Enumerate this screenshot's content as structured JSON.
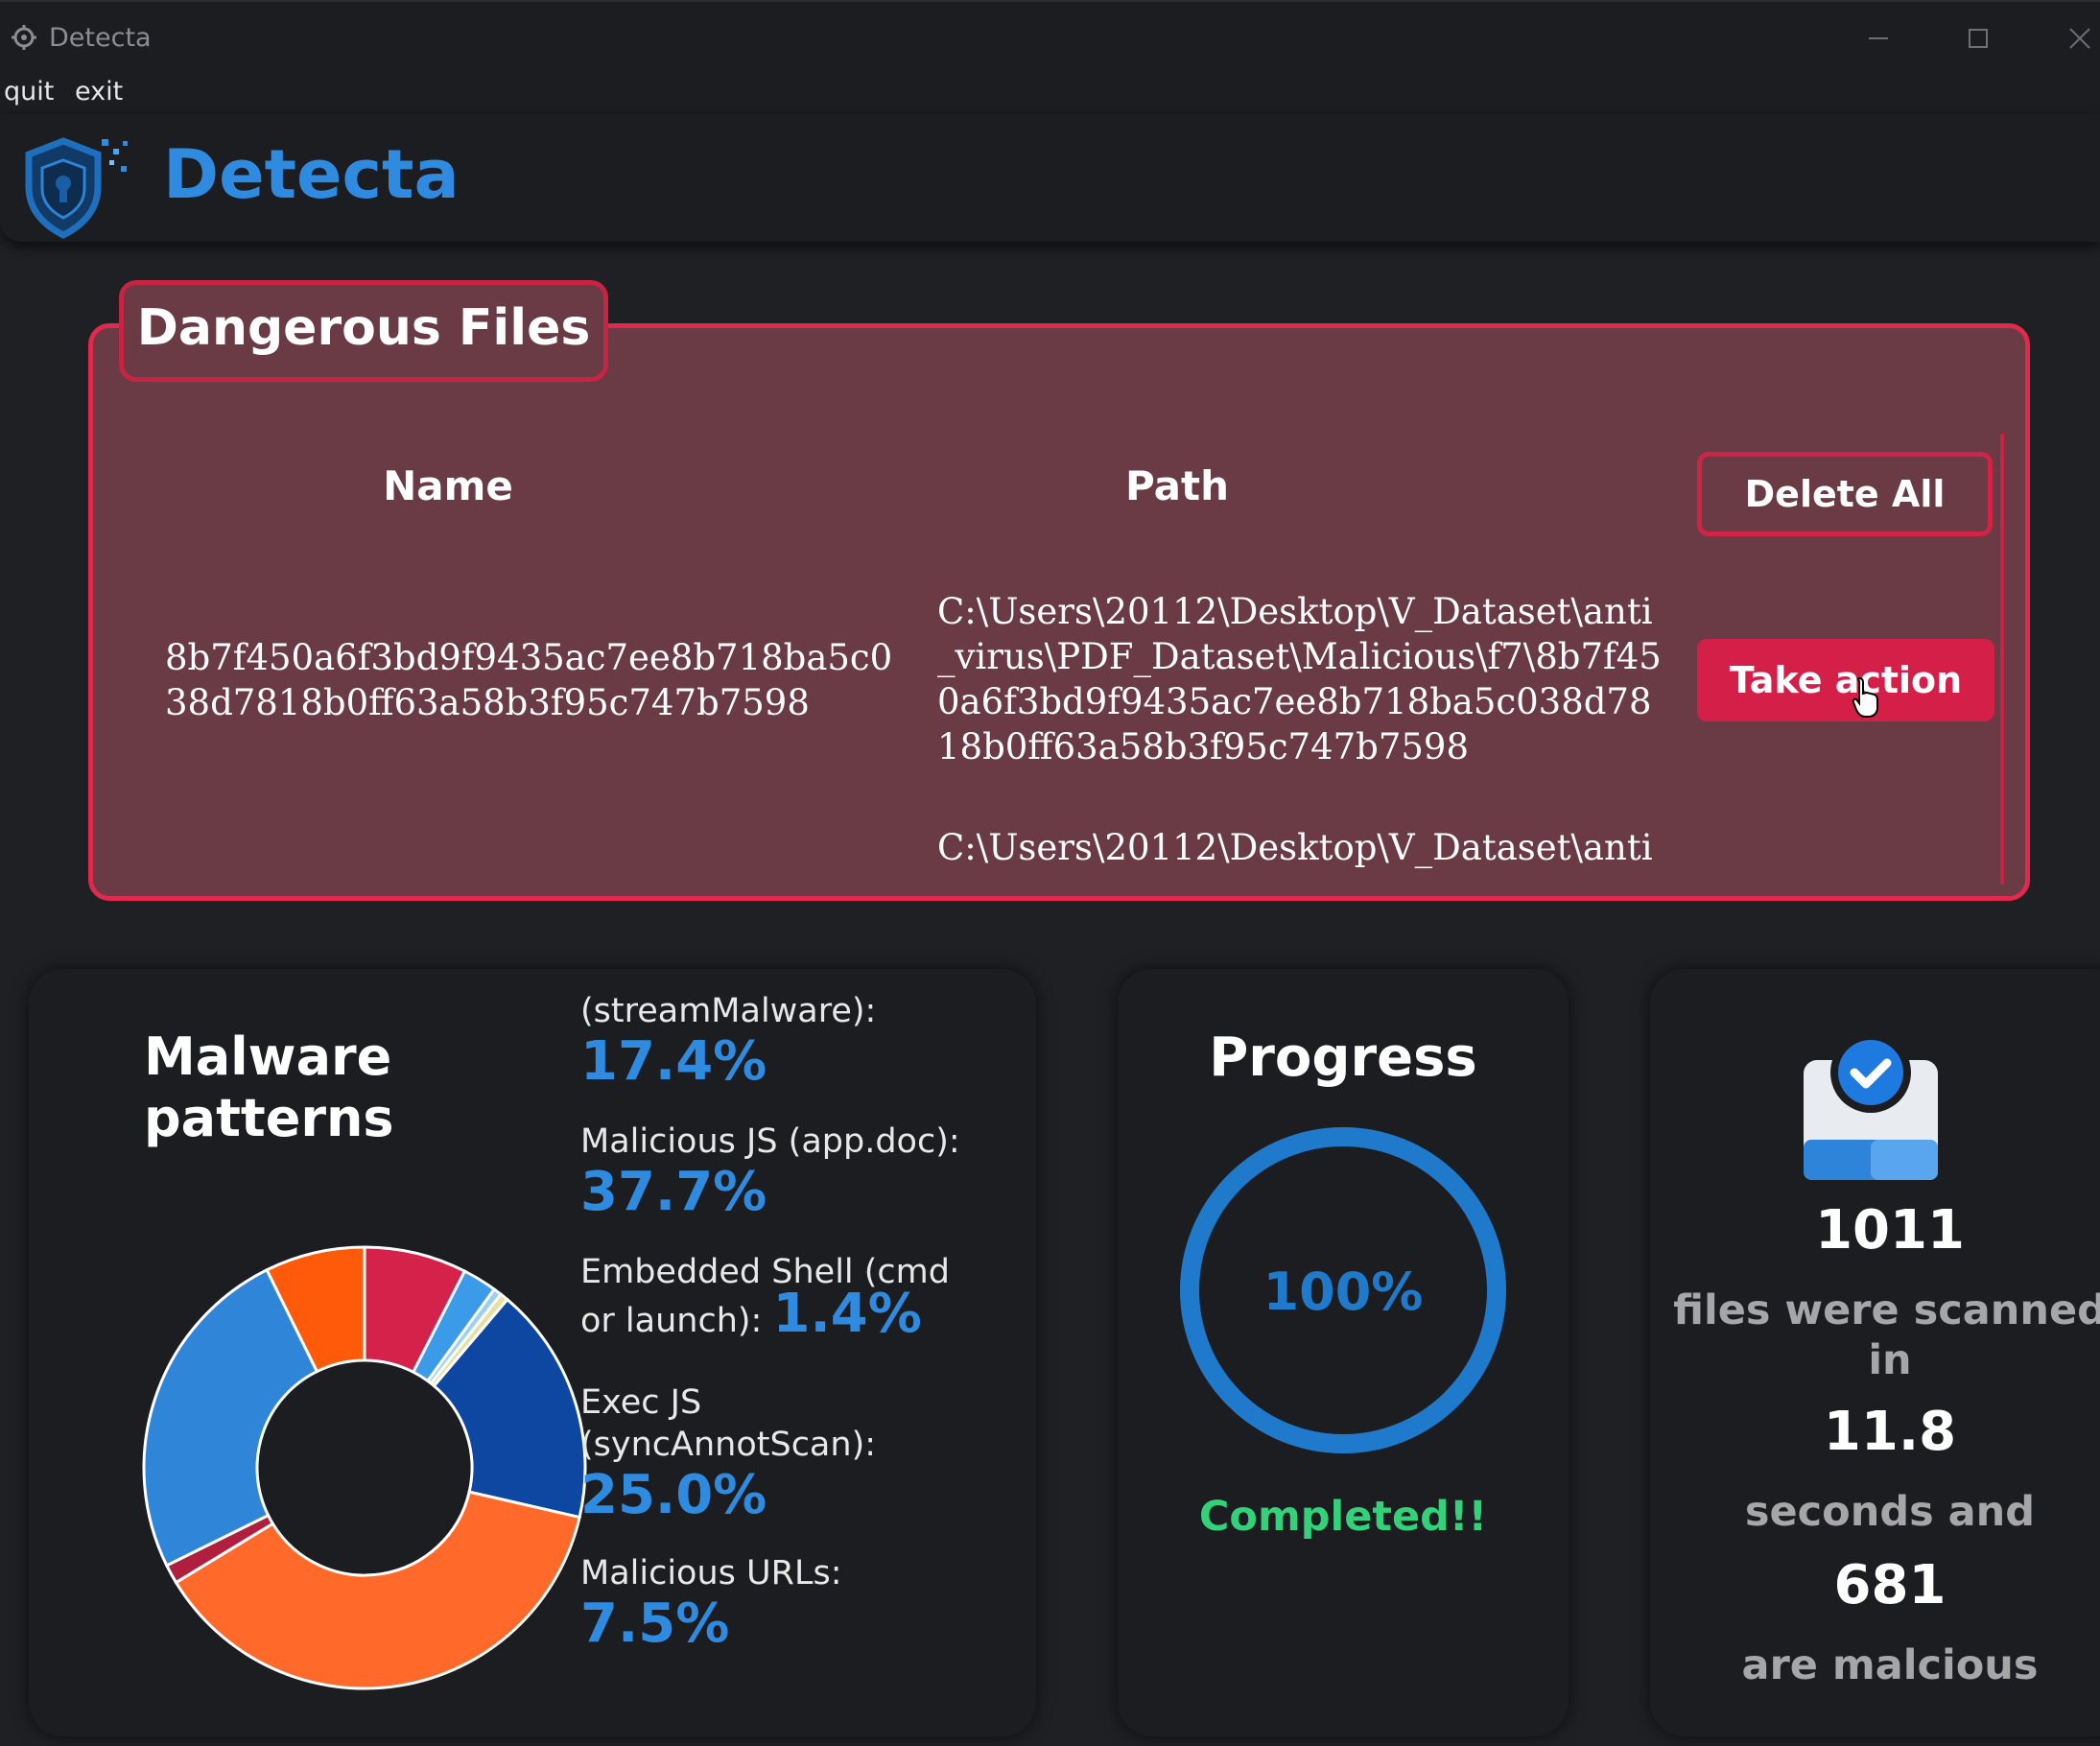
{
  "window": {
    "title": "Detecta"
  },
  "menu": {
    "quit": "quit",
    "exit": "exit"
  },
  "header": {
    "brand": "Detecta",
    "logo_icon": "shield-icon"
  },
  "dangerous_files": {
    "title": "Dangerous Files",
    "columns": {
      "name": "Name",
      "path": "Path"
    },
    "delete_all_label": "Delete All",
    "rows": [
      {
        "name": "8b7f450a6f3bd9f9435ac7ee8b718ba5c038d7818b0ff63a58b3f95c747b7598",
        "path": "C:\\Users\\20112\\Desktop\\V_Dataset\\anti_virus\\PDF_Dataset\\Malicious\\f7\\8b7f450a6f3bd9f9435ac7ee8b718ba5c038d7818b0ff63a58b3f95c747b7598",
        "action_label": "Take action"
      },
      {
        "name": "",
        "path": "C:\\Users\\20112\\Desktop\\V_Dataset\\anti",
        "action_label": ""
      }
    ]
  },
  "malware_patterns": {
    "title": "Malware patterns",
    "items": [
      {
        "label": "(streamMalware):",
        "value": "17.4%"
      },
      {
        "label": "Malicious JS (app.doc):",
        "value": "37.7%"
      },
      {
        "label": "Embedded Shell (cmd or launch):",
        "value": "1.4%"
      },
      {
        "label": "Exec JS (syncAnnotScan):",
        "value": "25.0%"
      },
      {
        "label": "Malicious URLs:",
        "value": "7.5%"
      }
    ],
    "chart_data": {
      "type": "pie",
      "slices": [
        {
          "value": 7.5,
          "color": "#d4224b"
        },
        {
          "value": 2.5,
          "color": "#3b9be8"
        },
        {
          "value": 0.6,
          "color": "#9ad0f5"
        },
        {
          "value": 0.6,
          "color": "#e8e0a0"
        },
        {
          "value": 17.4,
          "color": "#0d47a1"
        },
        {
          "value": 37.7,
          "color": "#ff6a2b"
        },
        {
          "value": 1.4,
          "color": "#b0203e"
        },
        {
          "value": 25.0,
          "color": "#2f86d8"
        },
        {
          "value": 7.3,
          "color": "#ff5a0a"
        }
      ]
    }
  },
  "progress": {
    "title": "Progress",
    "percent_label": "100%",
    "fraction": 1.0,
    "status": "Completed!!"
  },
  "stats": {
    "files_scanned": "1011",
    "files_text": "files were scanned in",
    "seconds": "11.8",
    "seconds_text": "seconds and",
    "malicious": "681",
    "malicious_text": "are malcious"
  },
  "colors": {
    "accent": "#2f8be0",
    "danger": "#e0294b",
    "panel": "#6a3a45",
    "success": "#33d17a"
  }
}
